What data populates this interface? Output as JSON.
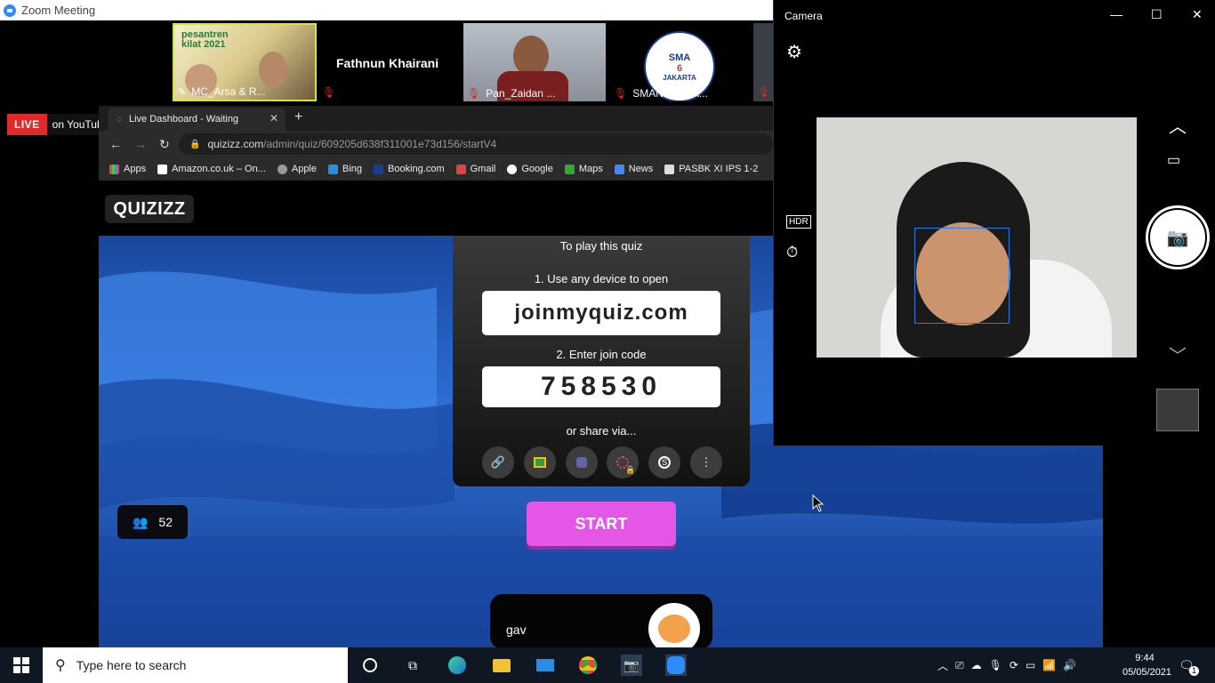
{
  "zoom": {
    "window_title": "Zoom Meeting",
    "participants": [
      {
        "name": "MC_Arsa & R..."
      },
      {
        "name": "Fathnun Khairani"
      },
      {
        "name": "Pan_Zaidan ..."
      },
      {
        "name": "SMAN6 JAKA..."
      }
    ],
    "tile_texts": {
      "poster": "pesantren kilat 2021",
      "sma_logo_top": "SMA",
      "sma_logo_num": "6",
      "sma_logo_bottom": "JAKARTA"
    },
    "live_badge": "LIVE",
    "live_destination": "on YouTube"
  },
  "browser": {
    "tab_title": "Live Dashboard - Waiting",
    "url_host": "quizizz.com",
    "url_path": "/admin/quiz/609205d638f311001e73d156/startV4",
    "bookmarks": [
      "Apps",
      "Amazon.co.uk – On...",
      "Apple",
      "Bing",
      "Booking.com",
      "Gmail",
      "Google",
      "Maps",
      "News",
      "PASBK XI IPS 1-2"
    ]
  },
  "quiz": {
    "logo": "QUIZIZZ",
    "instructions_title": "To play this quiz",
    "step1": "1. Use any device to open",
    "join_url": "joinmyquiz.com",
    "step2": "2. Enter join code",
    "join_code": "758530",
    "share_label": "or share via...",
    "share_icons": [
      "link-icon",
      "google-classroom-icon",
      "teams-icon",
      "remind-icon",
      "schoology-icon",
      "more-icon"
    ],
    "start_label": "START",
    "player_count": "52",
    "player_name": "gav"
  },
  "camera": {
    "title": "Camera"
  },
  "taskbar": {
    "search_placeholder": "Type here to search",
    "time": "9:44",
    "date": "05/05/2021",
    "notification_count": "1"
  },
  "colors": {
    "live_red": "#e02a2a",
    "start_button": "#e356e6",
    "quiz_bg": "#2562c8",
    "taskbar": "#0f1822"
  }
}
